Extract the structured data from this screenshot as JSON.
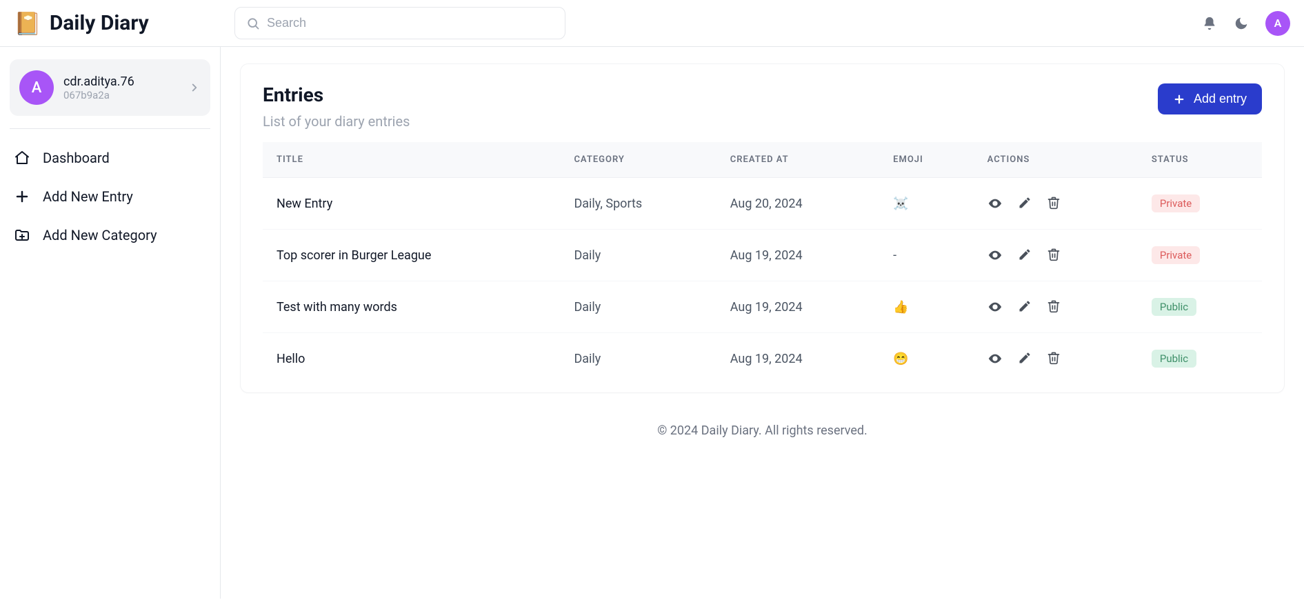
{
  "brand": {
    "icon": "📔",
    "title": "Daily Diary"
  },
  "search": {
    "placeholder": "Search"
  },
  "user": {
    "initial": "A",
    "name": "cdr.aditya.76",
    "id": "067b9a2a"
  },
  "nav": {
    "dashboard": "Dashboard",
    "add_entry": "Add New Entry",
    "add_category": "Add New Category"
  },
  "page": {
    "title": "Entries",
    "subtitle": "List of your diary entries",
    "add_button": "Add entry"
  },
  "table": {
    "headers": {
      "title": "TITLE",
      "category": "CATEGORY",
      "created": "CREATED AT",
      "emoji": "EMOJI",
      "actions": "ACTIONS",
      "status": "STATUS"
    },
    "rows": [
      {
        "title": "New Entry",
        "category": "Daily, Sports",
        "created": "Aug 20, 2024",
        "emoji": "☠️",
        "status": "Private"
      },
      {
        "title": "Top scorer in Burger League",
        "category": "Daily",
        "created": "Aug 19, 2024",
        "emoji": "-",
        "status": "Private"
      },
      {
        "title": "Test with many words",
        "category": "Daily",
        "created": "Aug 19, 2024",
        "emoji": "👍",
        "status": "Public"
      },
      {
        "title": "Hello",
        "category": "Daily",
        "created": "Aug 19, 2024",
        "emoji": "😁",
        "status": "Public"
      }
    ]
  },
  "footer": "© 2024 Daily Diary. All rights reserved."
}
